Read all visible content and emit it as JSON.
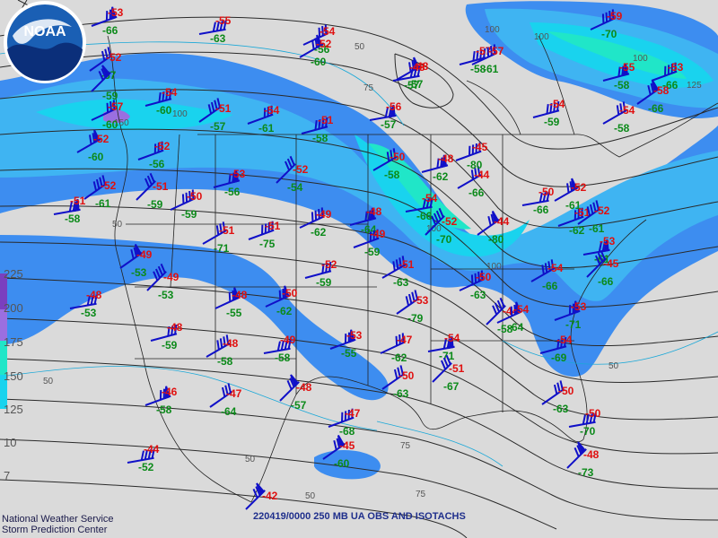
{
  "product": {
    "caption": "220419/0000 250 MB UA OBS AND ISOTACHS",
    "agency_line1": "National Weather Service",
    "agency_line2": "Storm Prediction Center",
    "logo_text": "NOAA"
  },
  "isotach_scale": [
    "225",
    "200",
    "175",
    "150",
    "125",
    "10",
    "7"
  ],
  "isotach_labels": [
    "50",
    "100",
    "150",
    "100",
    "100",
    "50",
    "100",
    "100",
    "100",
    "125",
    "50",
    "75",
    "75",
    "50",
    "50",
    "75",
    "50"
  ],
  "colors": {
    "isotach_50": "#3d8df0",
    "isotach_75": "#3fb4f2",
    "isotach_100": "#19d3ee",
    "isotach_125": "#20e6c8",
    "isotach_150": "#9b6fe0",
    "temperature": "#e01010",
    "dewpoint": "#0c8a1a",
    "barb": "#1010c8"
  },
  "observations": [
    {
      "temp": "-53",
      "dew": "-66"
    },
    {
      "temp": "-52",
      "dew": "-57"
    },
    {
      "temp": "-55",
      "dew": "-63"
    },
    {
      "temp": "",
      "dew": "-59"
    },
    {
      "temp": "-57",
      "dew": "-60"
    },
    {
      "temp": "-54",
      "dew": "-60"
    },
    {
      "temp": "-52",
      "dew": "-60"
    },
    {
      "temp": "-52",
      "dew": "-56"
    },
    {
      "temp": "-52",
      "dew": "-61"
    },
    {
      "temp": "-51",
      "dew": "-58"
    },
    {
      "temp": "-51",
      "dew": "-59"
    },
    {
      "temp": "-50",
      "dew": "-59"
    },
    {
      "temp": "-53",
      "dew": "-56"
    },
    {
      "temp": "-51",
      "dew": "-71"
    },
    {
      "temp": "-51",
      "dew": "-75"
    },
    {
      "temp": "-49",
      "dew": "-53"
    },
    {
      "temp": "-48",
      "dew": "-53"
    },
    {
      "temp": "-49",
      "dew": "-53"
    },
    {
      "temp": "-48",
      "dew": "-55"
    },
    {
      "temp": "-48",
      "dew": "-59"
    },
    {
      "temp": "-48",
      "dew": "-58"
    },
    {
      "temp": "-46",
      "dew": "-58"
    },
    {
      "temp": "-47",
      "dew": "-64"
    },
    {
      "temp": "-44",
      "dew": "-52"
    },
    {
      "temp": "-42",
      "dew": ""
    },
    {
      "temp": "-54",
      "dew": "-56"
    },
    {
      "temp": "-51",
      "dew": "-58"
    },
    {
      "temp": "-52",
      "dew": "-60"
    },
    {
      "temp": "-54",
      "dew": "-61"
    },
    {
      "temp": "-51",
      "dew": "-57"
    },
    {
      "temp": "-56",
      "dew": "-57"
    },
    {
      "temp": "-52",
      "dew": "-54"
    },
    {
      "temp": "-49",
      "dew": "-62"
    },
    {
      "temp": "-48",
      "dew": "-64"
    },
    {
      "temp": "-50",
      "dew": "-58"
    },
    {
      "temp": "-47",
      "dew": "-68"
    },
    {
      "temp": "-45",
      "dew": "-60"
    },
    {
      "temp": "-54",
      "dew": "-66"
    },
    {
      "temp": "-52",
      "dew": "-70"
    },
    {
      "temp": "-50",
      "dew": "-62"
    },
    {
      "temp": "-52",
      "dew": "-59"
    },
    {
      "temp": "-51",
      "dew": "-63"
    },
    {
      "temp": "-53",
      "dew": "-55"
    },
    {
      "temp": "-50",
      "dew": "-63"
    },
    {
      "temp": "-49",
      "dew": "-58"
    },
    {
      "temp": "-48",
      "dew": "-57"
    },
    {
      "temp": "-47",
      "dew": "-62"
    },
    {
      "temp": "-57",
      "dew": "-58"
    },
    {
      "temp": "-48",
      "dew": "-57"
    },
    {
      "temp": "-49",
      "dew": "-59"
    },
    {
      "temp": "-53",
      "dew": "-79"
    },
    {
      "temp": "-54",
      "dew": "-71"
    },
    {
      "temp": "-51",
      "dew": "-67"
    },
    {
      "temp": "-50",
      "dew": "-63"
    },
    {
      "temp": "-48",
      "dew": "-62"
    },
    {
      "temp": "-44",
      "dew": "-66"
    },
    {
      "temp": "-45",
      "dew": "-80"
    },
    {
      "temp": "-44",
      "dew": "-80"
    },
    {
      "temp": "-50",
      "dew": "-66"
    },
    {
      "temp": "-44",
      "dew": "-58"
    },
    {
      "temp": "-54",
      "dew": "-64"
    },
    {
      "temp": "-54",
      "dew": "-69"
    },
    {
      "temp": "-54",
      "dew": "-66"
    },
    {
      "temp": "-53",
      "dew": "-71"
    },
    {
      "temp": "-50",
      "dew": "-63"
    },
    {
      "temp": "-50",
      "dew": "-70"
    },
    {
      "temp": "-48",
      "dew": "-73"
    },
    {
      "temp": "-57",
      "dew": "-61"
    },
    {
      "temp": "-54",
      "dew": "-59"
    },
    {
      "temp": "-52",
      "dew": "-61"
    },
    {
      "temp": "-51",
      "dew": "-62"
    },
    {
      "temp": "-52",
      "dew": "-61"
    },
    {
      "temp": "-53",
      "dew": "-61"
    },
    {
      "temp": "-45",
      "dew": "-66"
    },
    {
      "temp": "-59",
      "dew": "-70"
    },
    {
      "temp": "-55",
      "dew": "-58"
    },
    {
      "temp": "-54",
      "dew": "-58"
    },
    {
      "temp": "-53",
      "dew": "-66"
    },
    {
      "temp": "-58",
      "dew": "-66"
    },
    {
      "temp": "-48",
      "dew": "-57"
    }
  ]
}
